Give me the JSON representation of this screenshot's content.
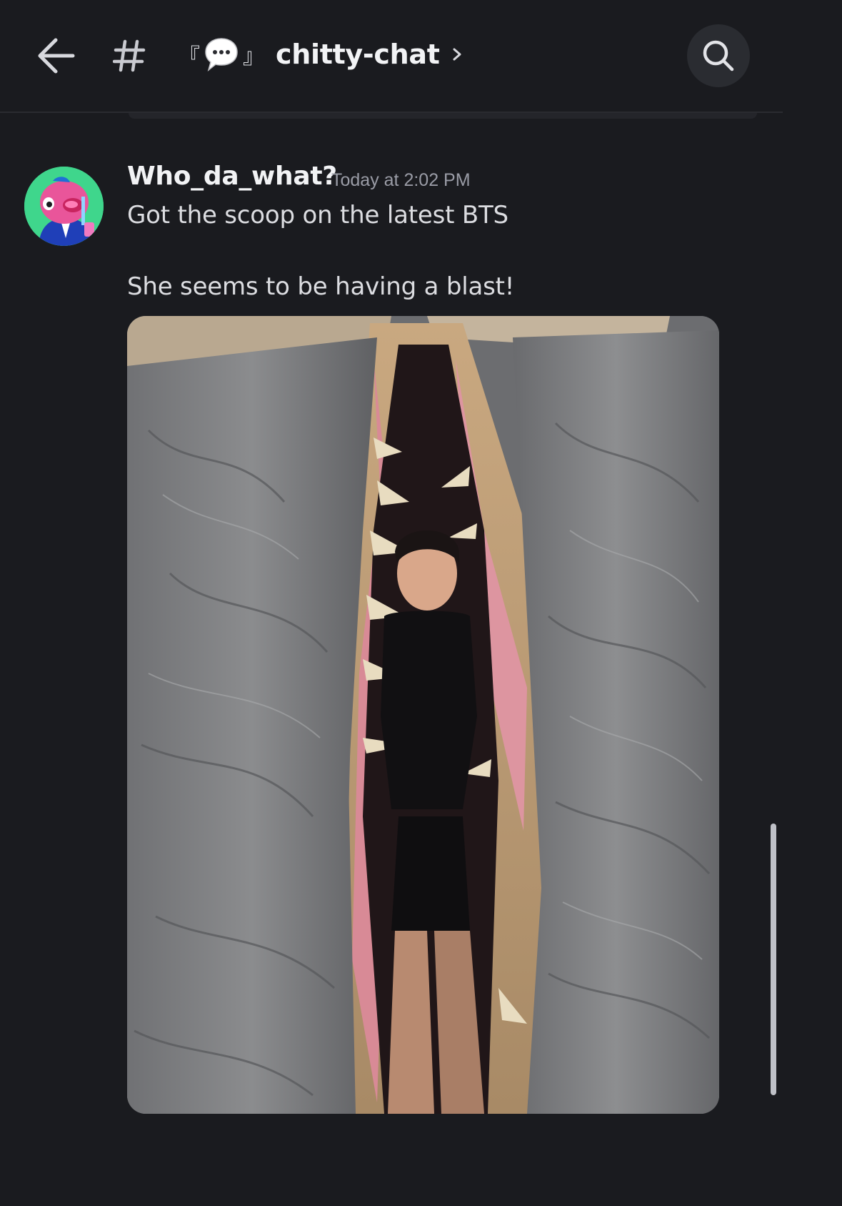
{
  "header": {
    "channel_prefix": "#",
    "bracket_open": "『",
    "bracket_close": "』",
    "channel_name": "chitty-chat"
  },
  "icons": {
    "back": "arrow-left-icon",
    "channel": "hash-icon",
    "bubble": "speech-bubble-icon",
    "chevron": "chevron-right-icon",
    "search": "search-icon"
  },
  "message": {
    "author": "Who_da_what?",
    "timestamp": "Today at 2:02 PM",
    "lines": [
      "Got the scoop on the latest BTS",
      "She seems to be having a blast!"
    ]
  },
  "colors": {
    "background": "#1a1b1f",
    "text": "#dcdde1",
    "muted": "#9a9ca6",
    "avatar_bg": "#3fd68c"
  }
}
